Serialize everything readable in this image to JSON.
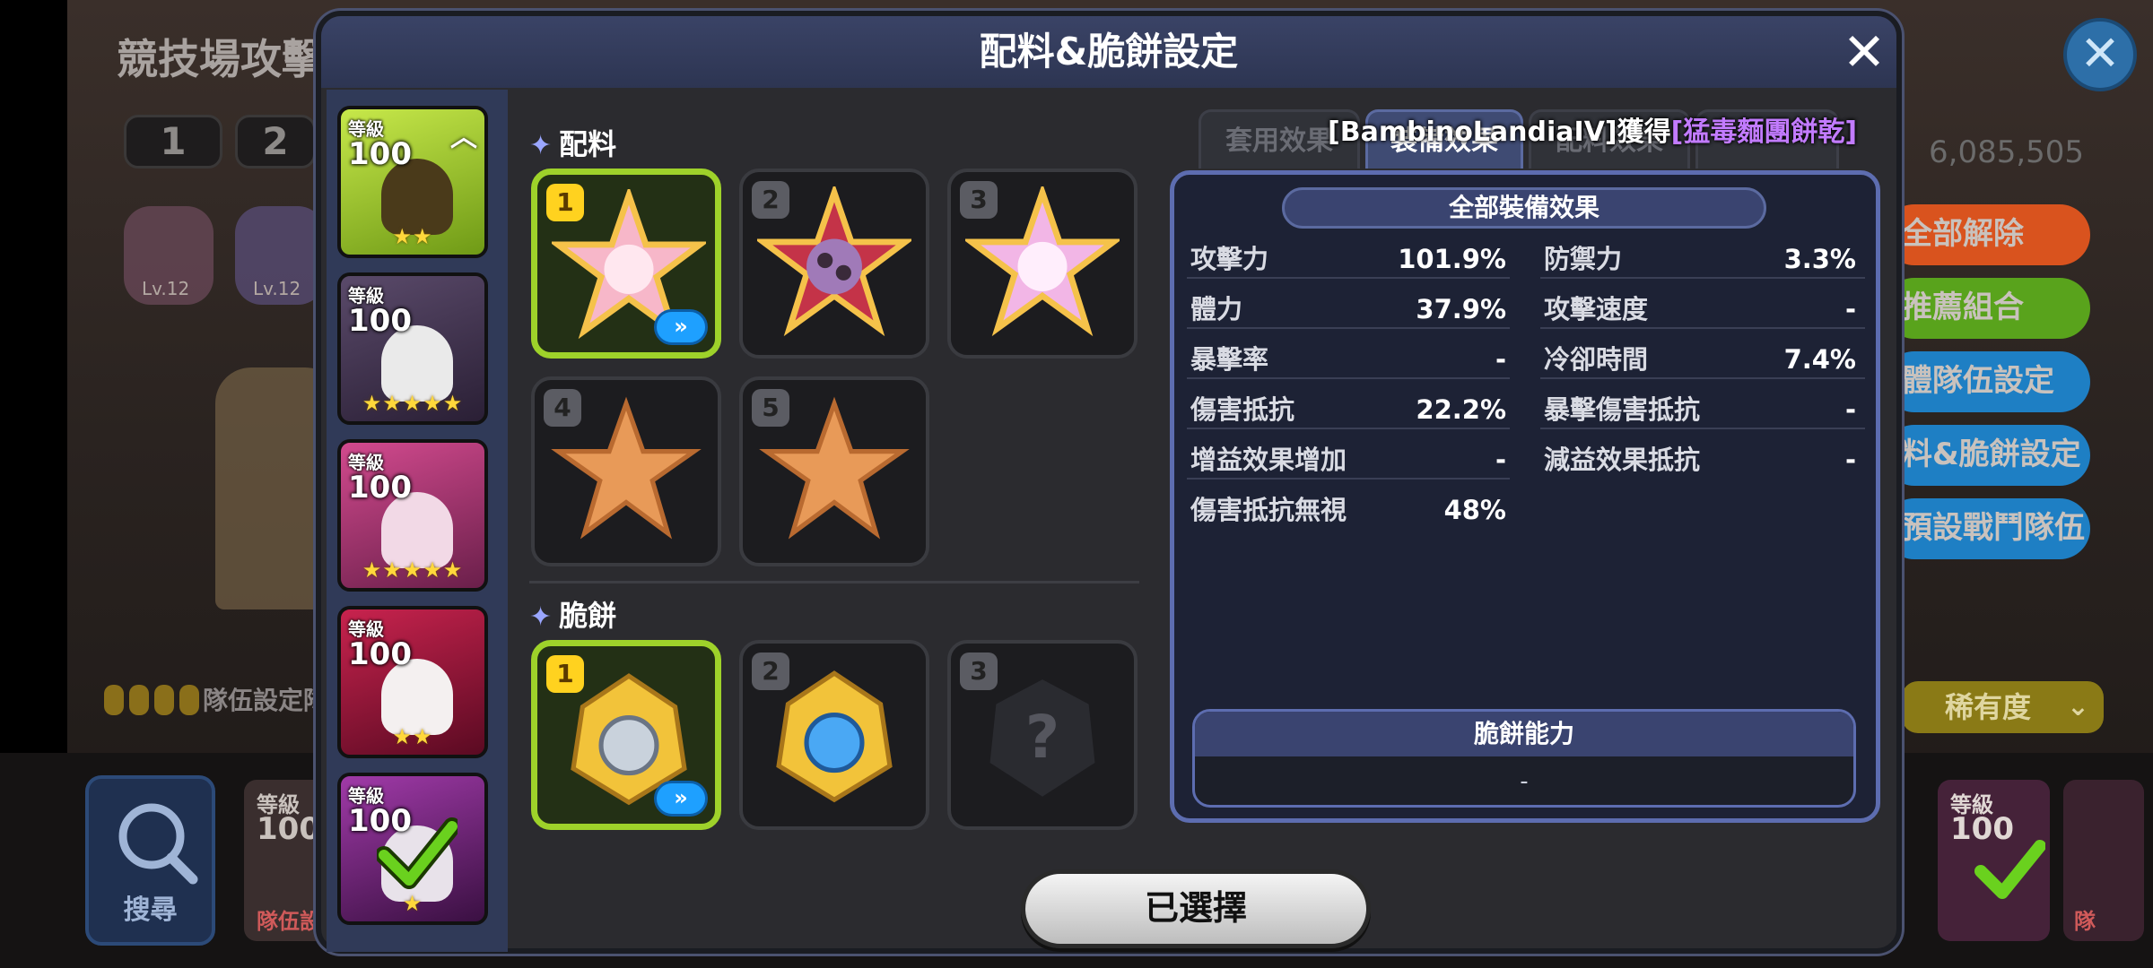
{
  "background": {
    "title": "競技場攻擊",
    "numbers": [
      "1",
      "2"
    ],
    "level_badges": [
      "Lv.12",
      "Lv.12"
    ],
    "team_hint": "隊伍設定降",
    "side_buttons": [
      {
        "label": "全部解除",
        "color": "#d9531e"
      },
      {
        "label": "推薦組合",
        "color": "#59a31c"
      },
      {
        "label": "體隊伍設定",
        "color": "#1e7fc4"
      },
      {
        "label": "料&脆餅設定",
        "color": "#1e7fc4"
      },
      {
        "label": "預設戰鬥隊伍",
        "color": "#1e7fc4"
      }
    ],
    "right_number": "6,085,505",
    "rarity_label": "稀有度",
    "search_label": "搜尋",
    "bottom_card_labels": [
      "等級",
      "100",
      "隊伍設",
      "等級",
      "100",
      "隊"
    ]
  },
  "modal": {
    "title": "配料&脆餅設定",
    "close_icon": "close-icon"
  },
  "sidebar": {
    "cards": [
      {
        "level_label": "等級",
        "level": "100",
        "stars": "★★",
        "bg": "#9bc42a"
      },
      {
        "level_label": "等級",
        "level": "100",
        "stars": "★★★★★",
        "bg": "#4a3556"
      },
      {
        "level_label": "等級",
        "level": "100",
        "stars": "★★★★★",
        "bg": "#a13b73"
      },
      {
        "level_label": "等級",
        "level": "100",
        "stars": "★★",
        "bg": "#a1183b"
      },
      {
        "level_label": "等級",
        "level": "100",
        "stars": "★",
        "bg": "#7a2a8a"
      }
    ]
  },
  "toppings": {
    "label": "配料",
    "slots": [
      {
        "num": "1",
        "state": "selected",
        "has_upgrade": true
      },
      {
        "num": "2",
        "state": "filled"
      },
      {
        "num": "3",
        "state": "filled"
      },
      {
        "num": "4",
        "state": "empty"
      },
      {
        "num": "5",
        "state": "empty"
      }
    ]
  },
  "tarts": {
    "label": "脆餅",
    "slots": [
      {
        "num": "1",
        "state": "selected",
        "has_upgrade": true
      },
      {
        "num": "2",
        "state": "filled"
      },
      {
        "num": "3",
        "state": "locked",
        "mark": "?"
      }
    ]
  },
  "tabs": [
    {
      "label": "套用效果",
      "active": false
    },
    {
      "label": "裝備效果",
      "active": true
    },
    {
      "label": "配料效果",
      "active": false
    },
    {
      "label": "",
      "active": false
    }
  ],
  "notice": {
    "prefix": "[BambinoLandiaIV]獲得",
    "item": "[猛毒麵團餅乾]"
  },
  "stats": {
    "heading": "全部裝備效果",
    "left": [
      {
        "name": "攻擊力",
        "value": "101.9%"
      },
      {
        "name": "體力",
        "value": "37.9%"
      },
      {
        "name": "暴擊率",
        "value": "-"
      },
      {
        "name": "傷害抵抗",
        "value": "22.2%"
      },
      {
        "name": "增益效果增加",
        "value": "-"
      },
      {
        "name": "傷害抵抗無視",
        "value": "48%"
      }
    ],
    "right": [
      {
        "name": "防禦力",
        "value": "3.3%"
      },
      {
        "name": "攻擊速度",
        "value": "-"
      },
      {
        "name": "冷卻時間",
        "value": "7.4%"
      },
      {
        "name": "暴擊傷害抵抗",
        "value": "-"
      },
      {
        "name": "減益效果抵抗",
        "value": "-"
      }
    ],
    "ability_heading": "脆餅能力",
    "ability_value": "-"
  },
  "footer": {
    "selected_label": "已選擇"
  },
  "colors": {
    "accent_green": "#9ed22a",
    "slot_gold": "#ffd21f",
    "panel_border": "#5d6db0",
    "notice_purple": "#c27bff"
  }
}
